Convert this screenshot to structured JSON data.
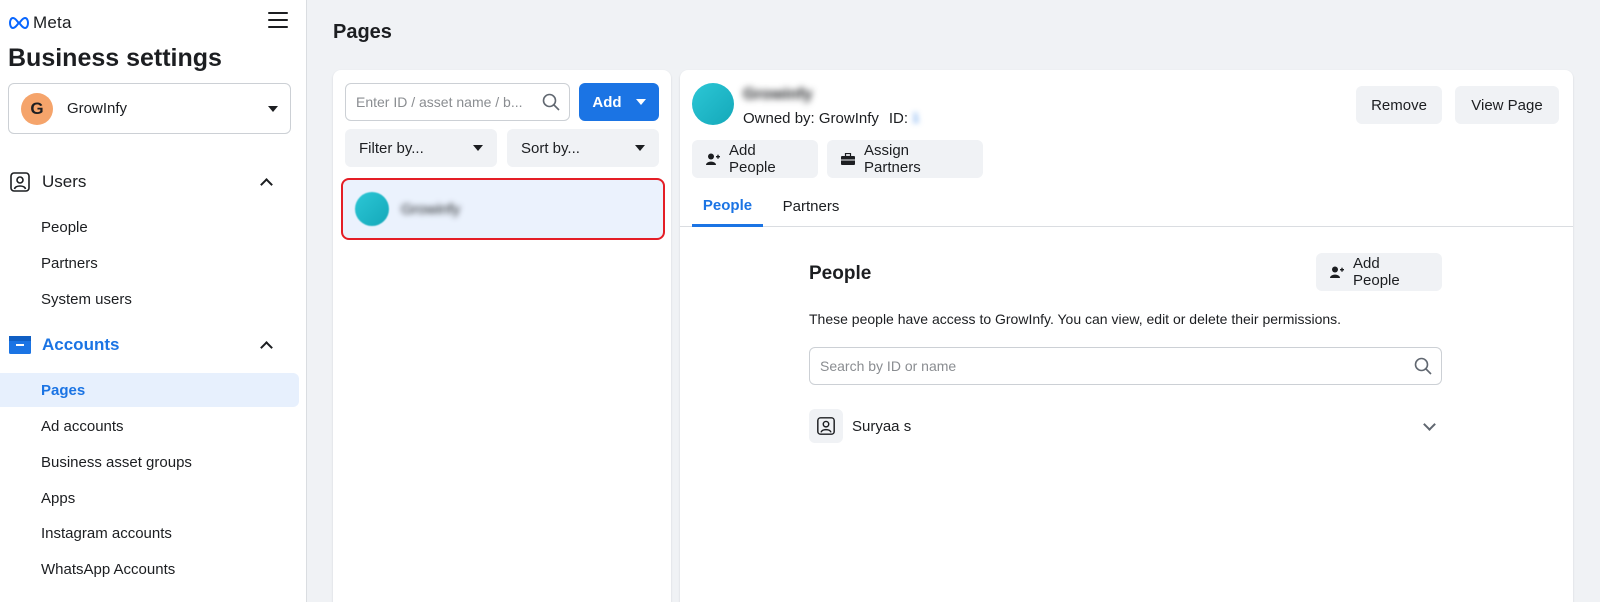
{
  "brand": {
    "name": "Meta"
  },
  "sidebar": {
    "title": "Business settings",
    "business": {
      "initial": "G",
      "name": "GrowInfy",
      "avatar_color": "#f5a46b"
    },
    "sections": [
      {
        "label": "Users",
        "items": [
          "People",
          "Partners",
          "System users"
        ]
      },
      {
        "label": "Accounts",
        "items": [
          "Pages",
          "Ad accounts",
          "Business asset groups",
          "Apps",
          "Instagram accounts",
          "WhatsApp Accounts"
        ]
      }
    ],
    "selected_item": "Pages"
  },
  "main": {
    "title": "Pages",
    "list": {
      "search_placeholder": "Enter ID / asset name / b...",
      "add_label": "Add",
      "filter_label": "Filter by...",
      "sort_label": "Sort by...",
      "selected_page_name": "Growinfy"
    },
    "detail": {
      "page_name": "Growinfy",
      "owned_by": "Owned by: GrowInfy",
      "id_label": "ID:",
      "id_value": "1",
      "remove_label": "Remove",
      "view_page_label": "View Page",
      "add_people_label": "Add People",
      "assign_partners_label": "Assign Partners",
      "tabs": [
        "People",
        "Partners"
      ],
      "active_tab": "People",
      "people": {
        "heading": "People",
        "add_people_label": "Add People",
        "description": "These people have access to GrowInfy. You can view, edit or delete their permissions.",
        "search_placeholder": "Search by ID or name",
        "persons": [
          {
            "name": "Suryaa s"
          }
        ]
      }
    }
  },
  "colors": {
    "accent": "#1b74e4",
    "highlight_border": "#e41e26",
    "selected_bg": "#e7f0fd"
  }
}
